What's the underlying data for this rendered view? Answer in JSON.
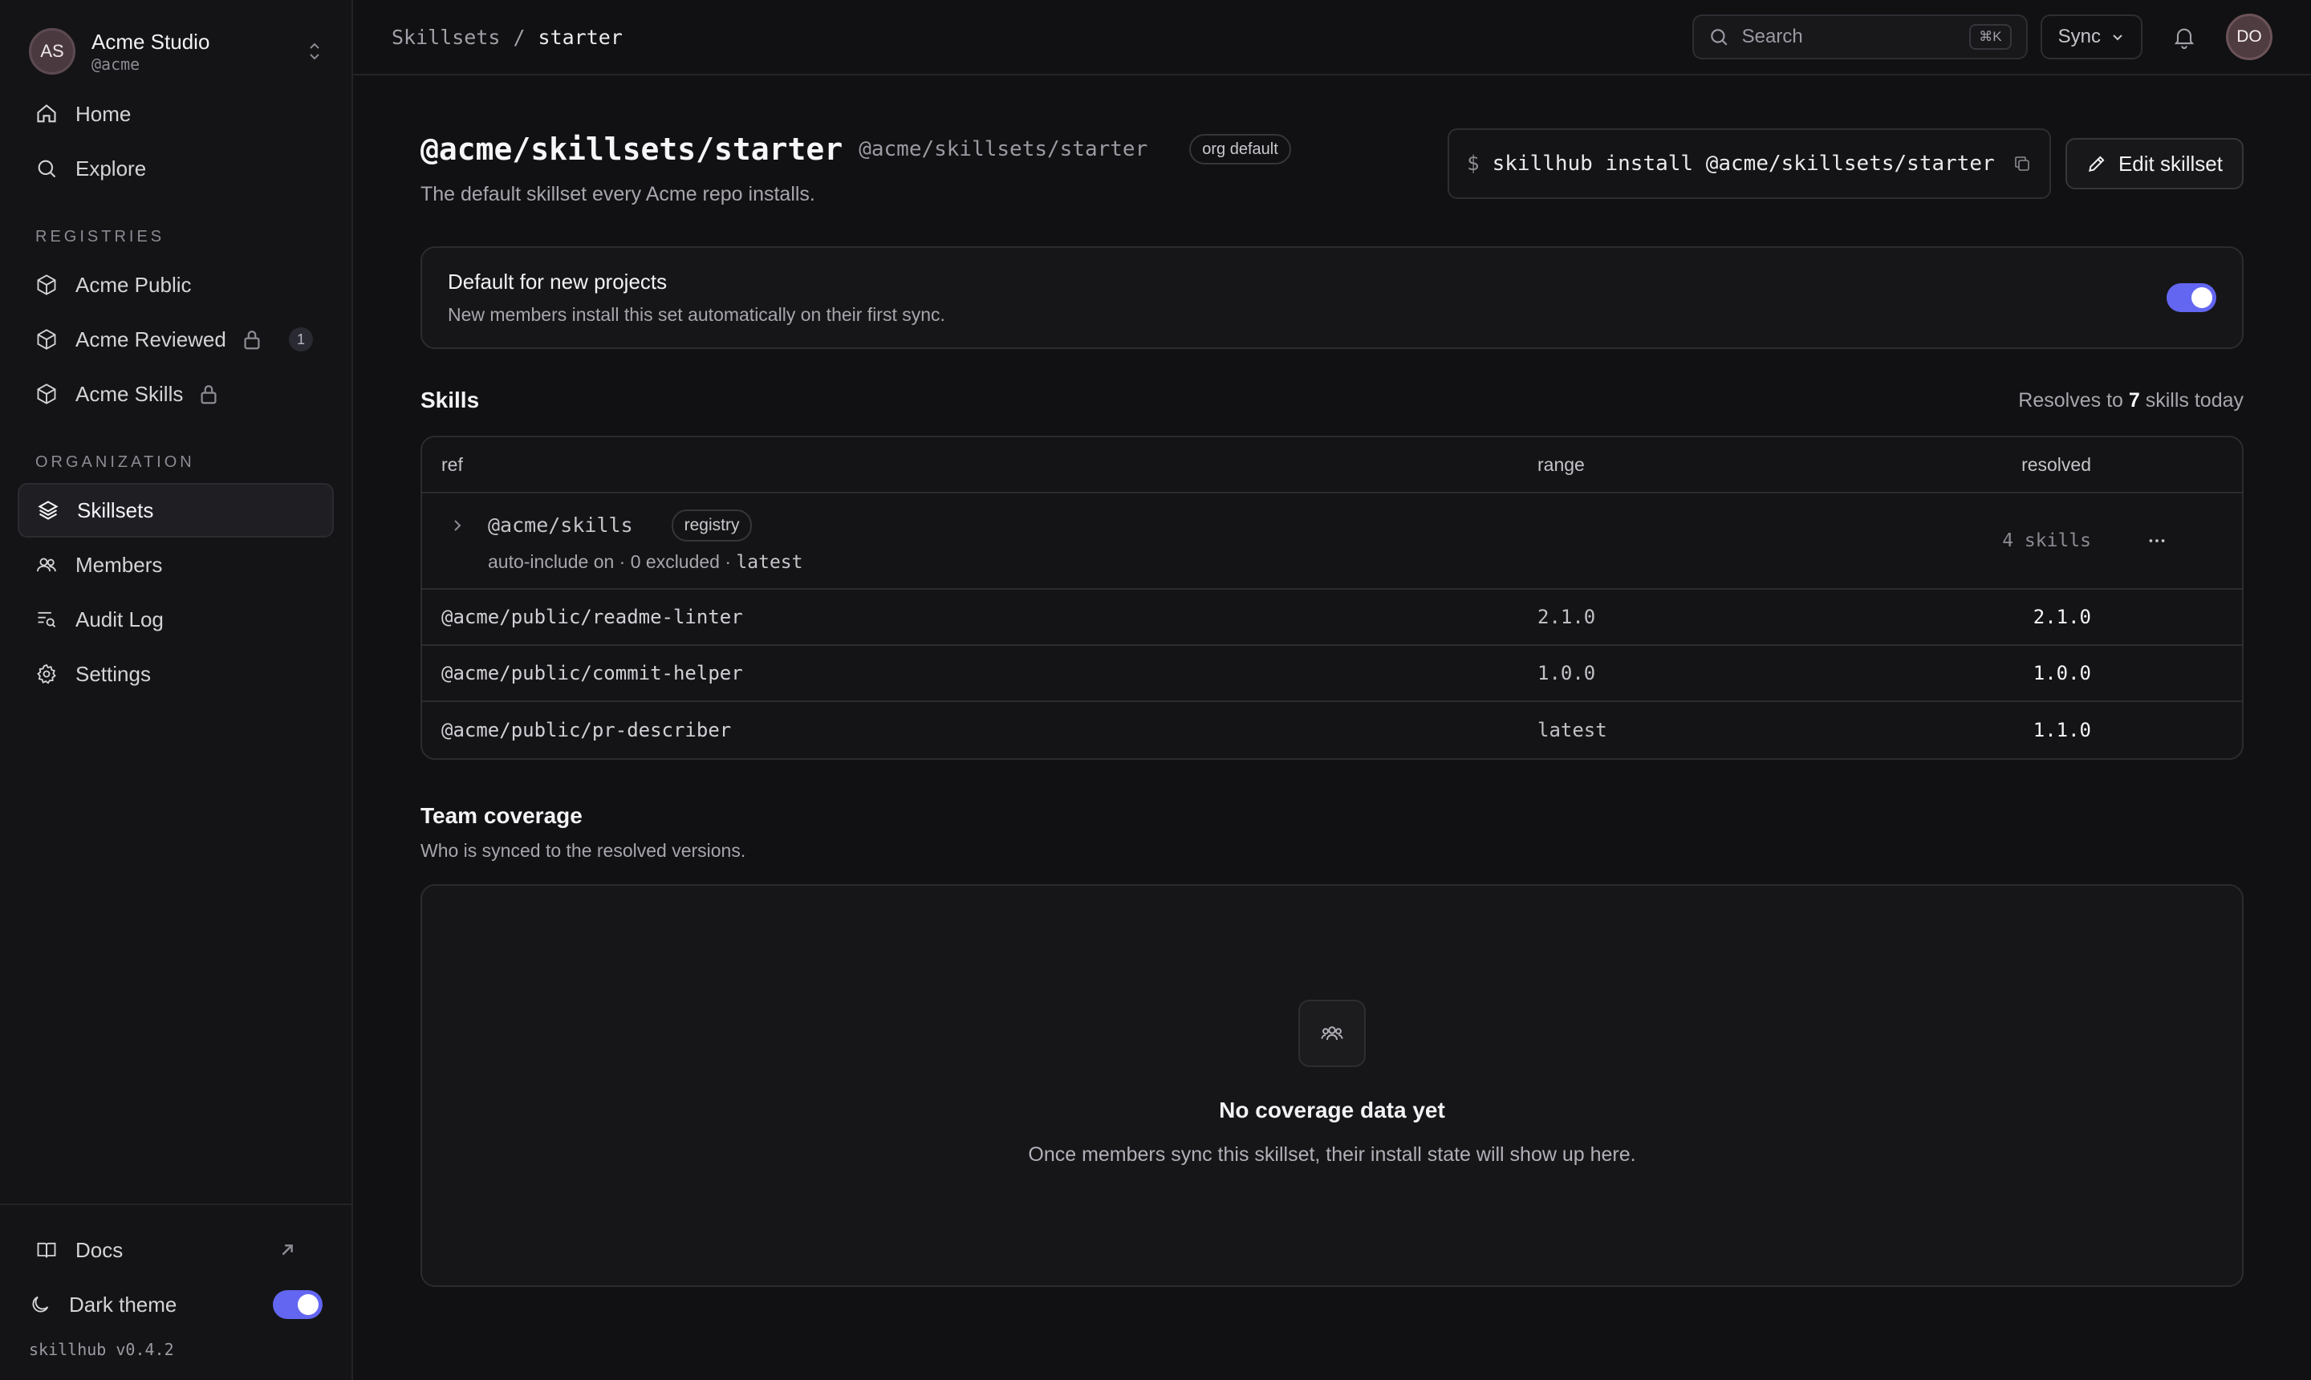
{
  "org": {
    "initials": "AS",
    "name": "Acme Studio",
    "handle": "@acme"
  },
  "nav": {
    "home": "Home",
    "explore": "Explore",
    "registries_label": "REGISTRIES",
    "registries": [
      {
        "label": "Acme Public"
      },
      {
        "label": "Acme Reviewed",
        "count": "1"
      },
      {
        "label": "Acme Skills"
      }
    ],
    "organization_label": "ORGANIZATION",
    "organization": [
      {
        "label": "Skillsets"
      },
      {
        "label": "Members"
      },
      {
        "label": "Audit Log"
      },
      {
        "label": "Settings"
      }
    ],
    "docs": "Docs",
    "dark_theme": "Dark theme",
    "version": "skillhub v0.4.2"
  },
  "topbar": {
    "crumbs": [
      "Skillsets",
      "/",
      "starter"
    ],
    "search_placeholder": "Search",
    "search_kbd": "⌘K",
    "sync": "Sync",
    "user_initials": "DO"
  },
  "skillset": {
    "title": "@acme/skillsets/starter",
    "subtitle": "@acme/skillsets/starter",
    "badge": "org default",
    "description": "The default skillset every Acme repo installs.",
    "install_prefix": "$",
    "install_command": "skillhub install @acme/skillsets/starter",
    "edit_label": "Edit skillset"
  },
  "default_card": {
    "title": "Default for new projects",
    "description": "New members install this set automatically on their first sync.",
    "enabled": true
  },
  "skills": {
    "heading": "Skills",
    "resolves_prefix": "Resolves to",
    "resolves_count": "7",
    "resolves_suffix": "skills today",
    "columns": {
      "ref": "ref",
      "range": "range",
      "resolved": "resolved"
    },
    "group": {
      "ref": "@acme/skills",
      "badge": "registry",
      "meta_text": "auto-include on · 0 excluded ·",
      "meta_tag": "latest",
      "resolved": "4 skills"
    },
    "rows": [
      {
        "ref": "@acme/public/readme-linter",
        "range": "2.1.0",
        "resolved": "2.1.0"
      },
      {
        "ref": "@acme/public/commit-helper",
        "range": "1.0.0",
        "resolved": "1.0.0"
      },
      {
        "ref": "@acme/public/pr-describer",
        "range": "latest",
        "resolved": "1.1.0"
      }
    ]
  },
  "coverage": {
    "heading": "Team coverage",
    "description": "Who is synced to the resolved versions.",
    "empty_title": "No coverage data yet",
    "empty_desc": "Once members sync this skillset, their install state will show up here."
  },
  "colors": {
    "accent": "#6366f1",
    "background": "#111113",
    "sidebar": "#141416"
  }
}
